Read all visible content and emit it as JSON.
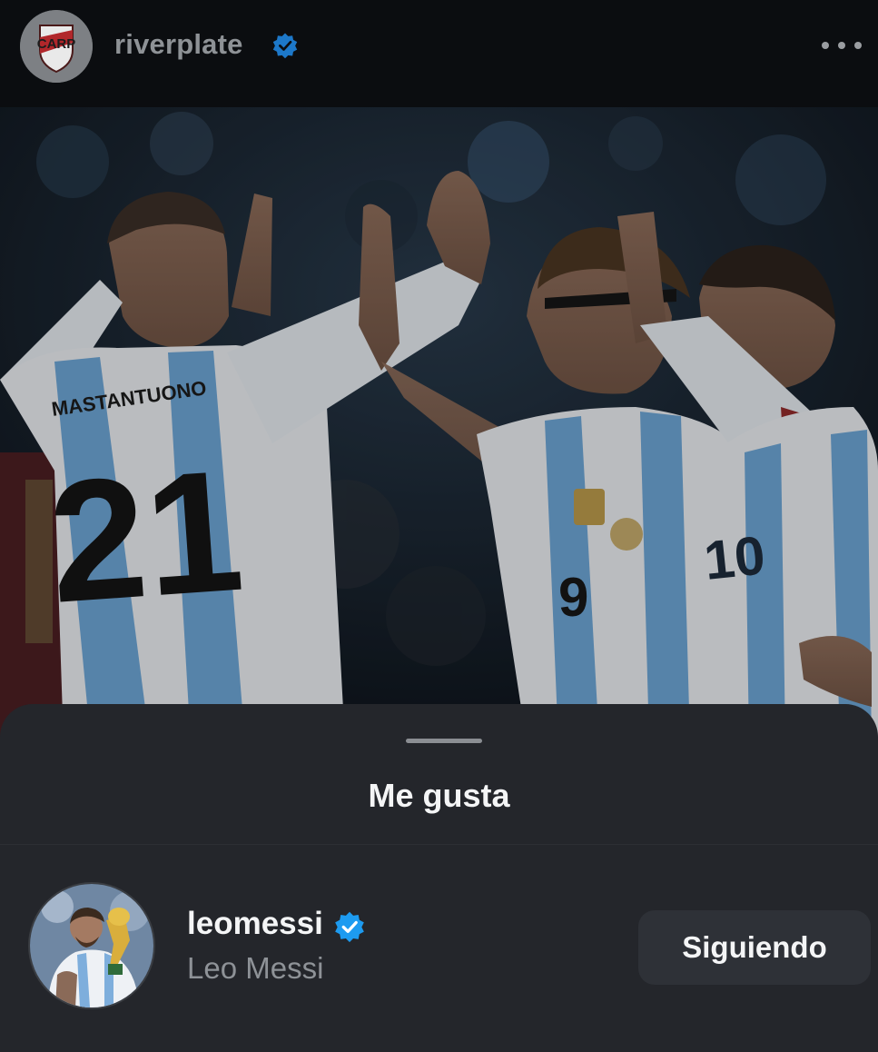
{
  "post": {
    "username": "riverplate",
    "verified": true,
    "more_icon": "more-horizontal-icon",
    "logo_lettering": "CARP",
    "photo": {
      "description_icon": "photo",
      "jersey_numbers": [
        "21",
        "9",
        "10"
      ],
      "jersey_name": "MASTANTUONO"
    }
  },
  "likes_sheet": {
    "title": "Me gusta",
    "users": [
      {
        "handle": "leomessi",
        "full_name": "Leo Messi",
        "verified": true,
        "follow_label": "Siguiendo"
      }
    ]
  },
  "colors": {
    "header_bg": "#0b0d10",
    "sheet_bg": "#24262b",
    "verified_blue": "#1d9bf0",
    "button_bg": "#2e3137",
    "text_primary": "#f4f5f6",
    "text_secondary": "#8e9297"
  }
}
